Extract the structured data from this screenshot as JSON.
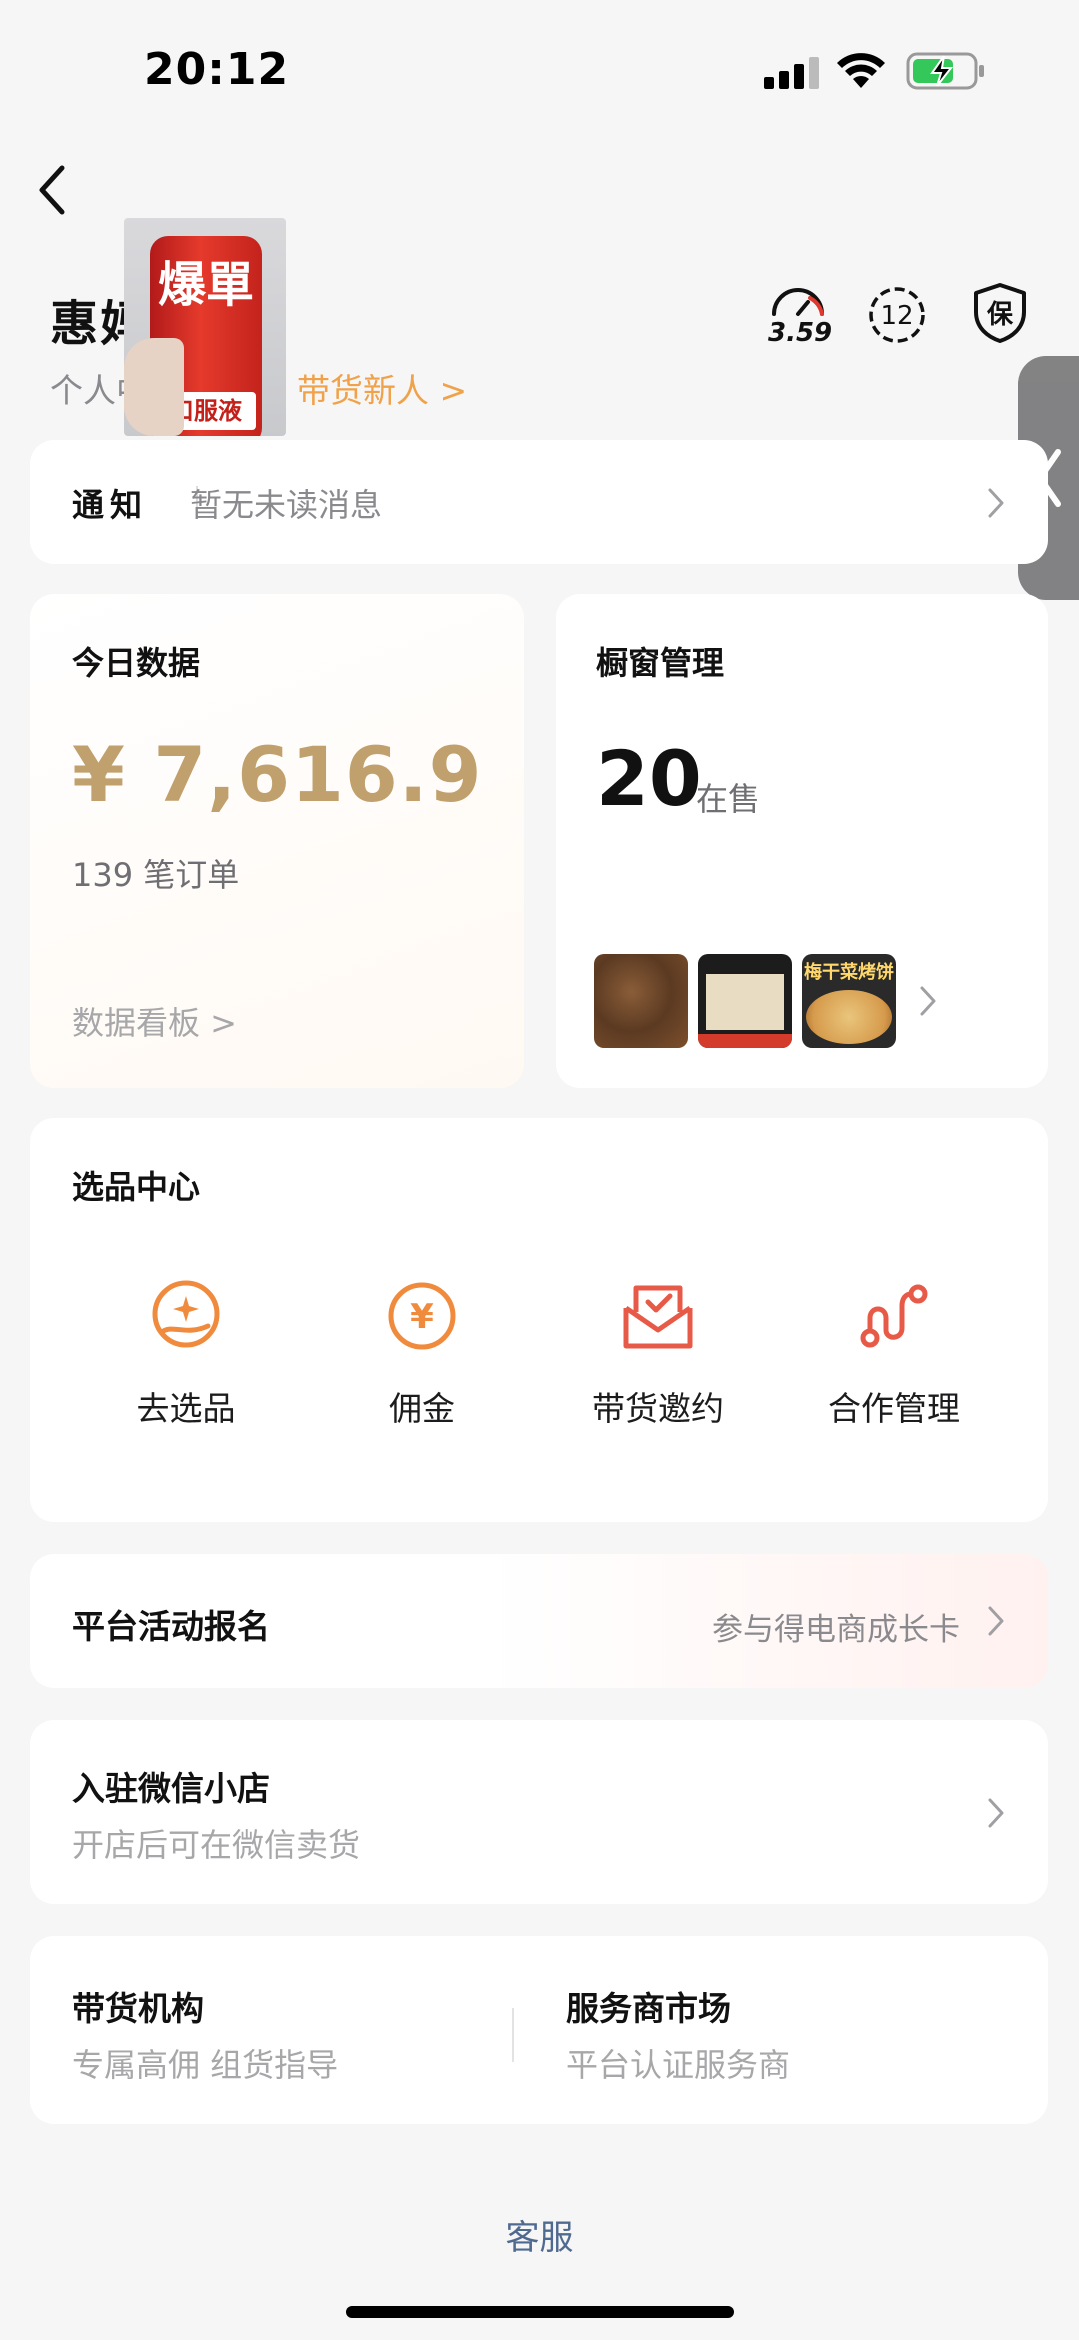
{
  "status_bar": {
    "time": "20:12"
  },
  "header": {
    "title": "惠妈        橱窗",
    "subtitle_left": "个人中",
    "level": "带货新人 >",
    "speed_score": "3.59",
    "badge_count": "12",
    "shield_label": "保"
  },
  "sticker": {
    "can_text": "爆單",
    "band_text": "口服液"
  },
  "notice": {
    "label": "通知",
    "text": "暂无未读消息"
  },
  "today": {
    "title": "今日数据",
    "amount": "¥ 7,616.9",
    "orders": "139 笔订单",
    "link": "数据看板 >"
  },
  "window": {
    "title": "橱窗管理",
    "count": "20",
    "count_label": "在售",
    "thumb3_text": "梅干菜烤饼"
  },
  "select_center": {
    "title": "选品中心",
    "items": [
      {
        "label": "去选品",
        "icon": "select-product-icon"
      },
      {
        "label": "佣金",
        "icon": "commission-icon"
      },
      {
        "label": "带货邀约",
        "icon": "invitation-icon"
      },
      {
        "label": "合作管理",
        "icon": "cooperation-icon"
      }
    ]
  },
  "activity": {
    "title": "平台活动报名",
    "right_text": "参与得电商成长卡"
  },
  "wechat_shop": {
    "title": "入驻微信小店",
    "subtitle": "开店后可在微信卖货"
  },
  "bottom": {
    "left_title": "带货机构",
    "left_sub": "专属高佣 组货指导",
    "right_title": "服务商市场",
    "right_sub": "平台认证服务商"
  },
  "footer": {
    "service": "客服"
  },
  "colors": {
    "accent_gold": "#c0a06c",
    "accent_orange": "#f0a24a",
    "link_blue": "#4f6a8f"
  }
}
